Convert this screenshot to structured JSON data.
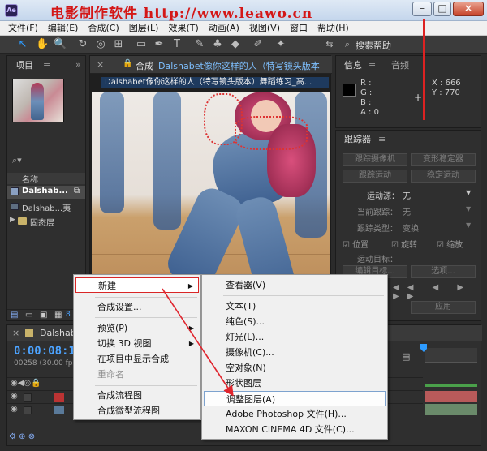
{
  "window": {
    "watermark": "电影制作软件  http://www.leawo.cn",
    "icon_label": "Ae",
    "controls": [
      "–",
      "□",
      "×"
    ]
  },
  "menubar": [
    "文件(F)",
    "编辑(E)",
    "合成(C)",
    "图层(L)",
    "效果(T)",
    "动画(A)",
    "视图(V)",
    "窗口",
    "帮助(H)"
  ],
  "toolbar": {
    "tools": [
      "select-arrow-icon",
      "hand-icon",
      "zoom-icon",
      "rotate-icon",
      "camera-orbit-icon",
      "pan-behind-icon",
      "rectangle-icon",
      "pen-icon",
      "type-icon",
      "brush-icon",
      "clone-stamp-icon",
      "eraser-icon",
      "roto-brush-icon",
      "puppet-pin-icon"
    ],
    "glyphs": [
      "↖",
      "✋",
      "🔍",
      "↻",
      "◎",
      "⊞",
      "▭",
      "✒",
      "T",
      "✎",
      "♣",
      "◆",
      "✐",
      "✦"
    ],
    "search_label": "搜索帮助"
  },
  "project": {
    "tab": "项目",
    "menu_icon": "≡",
    "column_name": "名称",
    "items": [
      "Dalshab...",
      "Dalshab...夷",
      "固态层"
    ],
    "footer_text": "8 b"
  },
  "composition": {
    "tab_label": "合成",
    "tab_name": "Dalshabet像你这样的人（特写镜头版本",
    "subtitle": "Dalshabet像你这样的人（特写镜头版本）舞蹈练习_高..."
  },
  "info": {
    "tab": "信息",
    "tab2": "音频",
    "rgba": [
      "R :",
      "G :",
      "B :",
      "A : 0"
    ],
    "x": "X : 666",
    "y": "Y : 770"
  },
  "tracker": {
    "tab": "跟踪器",
    "btn_track_camera": "跟踪摄像机",
    "btn_warp_stabilizer": "变形稳定器",
    "btn_track_motion": "跟踪运动",
    "btn_stabilize_motion": "稳定运动",
    "motion_source_label": "运动源：",
    "motion_source_value": "无",
    "current_track_label": "当前跟踪：",
    "current_track_value": "无",
    "track_type_label": "跟踪类型：",
    "track_type_value": "变换",
    "check_position": "位置",
    "check_rotation": "旋转",
    "check_scale": "缩放",
    "motion_target_label": "运动目标：",
    "btn_edit_target": "编辑目标...",
    "btn_options": "选项...",
    "btn_apply": "应用"
  },
  "timeline": {
    "tab": "Dalshabe",
    "timecode": "0:00:08:18",
    "fps": "00258 (30.00 fps)"
  },
  "context_menu": {
    "items": [
      "新建",
      "合成设置...",
      "预览(P)",
      "切换 3D 视图",
      "在项目中显示合成",
      "重命名",
      "合成流程图",
      "合成微型流程图"
    ],
    "submenu_arrow": "▶"
  },
  "submenu": {
    "items": [
      "查看器(V)",
      "文本(T)",
      "纯色(S)...",
      "灯光(L)...",
      "摄像机(C)...",
      "空对象(N)",
      "形状图层",
      "调整图层(A)",
      "Adobe Photoshop 文件(H)...",
      "MAXON CINEMA 4D 文件(C)..."
    ]
  },
  "colors": {
    "watermark": "#d41717",
    "timecode": "#4ca3ff",
    "highlight_border": "#d92626",
    "playhead": "#dd2222"
  }
}
